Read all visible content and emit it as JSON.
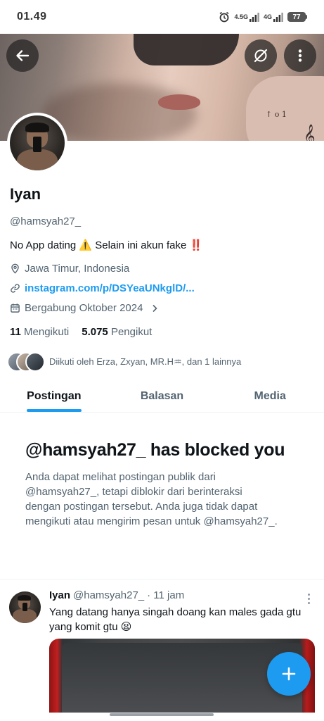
{
  "status_bar": {
    "time": "01.49",
    "network_1": "4.5G",
    "network_2": "4G",
    "battery": "77"
  },
  "header": {
    "back_icon": "arrow-left-icon",
    "grok_icon": "grok-icon",
    "more_icon": "more-vertical-icon"
  },
  "profile": {
    "name": "Iyan",
    "handle": "@hamsyah27_",
    "bio": "No App dating ⚠️ Selain ini akun fake ‼️",
    "location": "Jawa Timur, Indonesia",
    "link": "instagram.com/p/DSYeaUNkglD/...",
    "joined": "Bergabung Oktober 2024",
    "following_count": "11",
    "following_label": "Mengikuti",
    "followers_count": "5.075",
    "followers_label": "Pengikut",
    "followed_by": "Diikuti oleh Erza, Zxyan, MR.H♒, dan 1 lainnya"
  },
  "tabs": [
    {
      "label": "Postingan",
      "active": true
    },
    {
      "label": "Balasan",
      "active": false
    },
    {
      "label": "Media",
      "active": false
    }
  ],
  "blocked": {
    "title": "@hamsyah27_ has blocked you",
    "description": "Anda dapat melihat postingan publik dari @hamsyah27_, tetapi diblokir dari berinteraksi dengan postingan tersebut. Anda juga tidak dapat mengikuti atau mengirim pesan untuk @hamsyah27_."
  },
  "tweet": {
    "name": "Iyan",
    "handle": "@hamsyah27_",
    "time": "· 11 jam",
    "text": "Yang datang hanya singah doang kan males gada gtu yang komit gtu 😫"
  },
  "colors": {
    "accent": "#1d9bf0",
    "text_primary": "#0f1419",
    "text_secondary": "#536471"
  }
}
